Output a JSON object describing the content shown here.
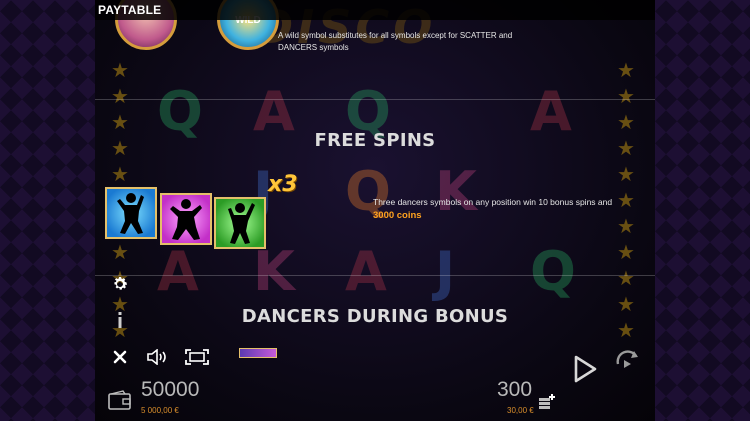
{
  "title_bar": {
    "title": "PAYTABLE"
  },
  "game_logo": {
    "text": "DISCO"
  },
  "wild_section": {
    "description": "A wild symbol substitutes for all symbols except for SCATTER and DANCERS symbols",
    "symbols": [
      "dancer-face-symbol",
      "wild-symbol"
    ]
  },
  "free_spins": {
    "title": "FREE SPINS",
    "multiplier": "x3",
    "description": "Three dancers symbols on any position win 10 bonus spins and",
    "coins": "3000 coins",
    "card_colors": [
      "#1a7ad2",
      "#c330c8",
      "#2c9c25"
    ]
  },
  "bonus_section": {
    "title": "DANCERS DURING BONUS"
  },
  "controls": {
    "settings_icon": "gear-icon",
    "info_icon": "info-icon",
    "close_icon": "close-icon",
    "sound_icon": "speaker-icon",
    "fullscreen_icon": "fullscreen-icon",
    "play_icon": "play-icon",
    "autoplay_icon": "autoplay-icon"
  },
  "balance": {
    "credits": "50000",
    "money": "5 000,00 €"
  },
  "bet": {
    "credits": "300",
    "money": "30,00 €"
  },
  "colors": {
    "accent_gold": "#e4c06a",
    "coins_orange": "#ffa21f",
    "money_orange": "#d98e2c"
  }
}
